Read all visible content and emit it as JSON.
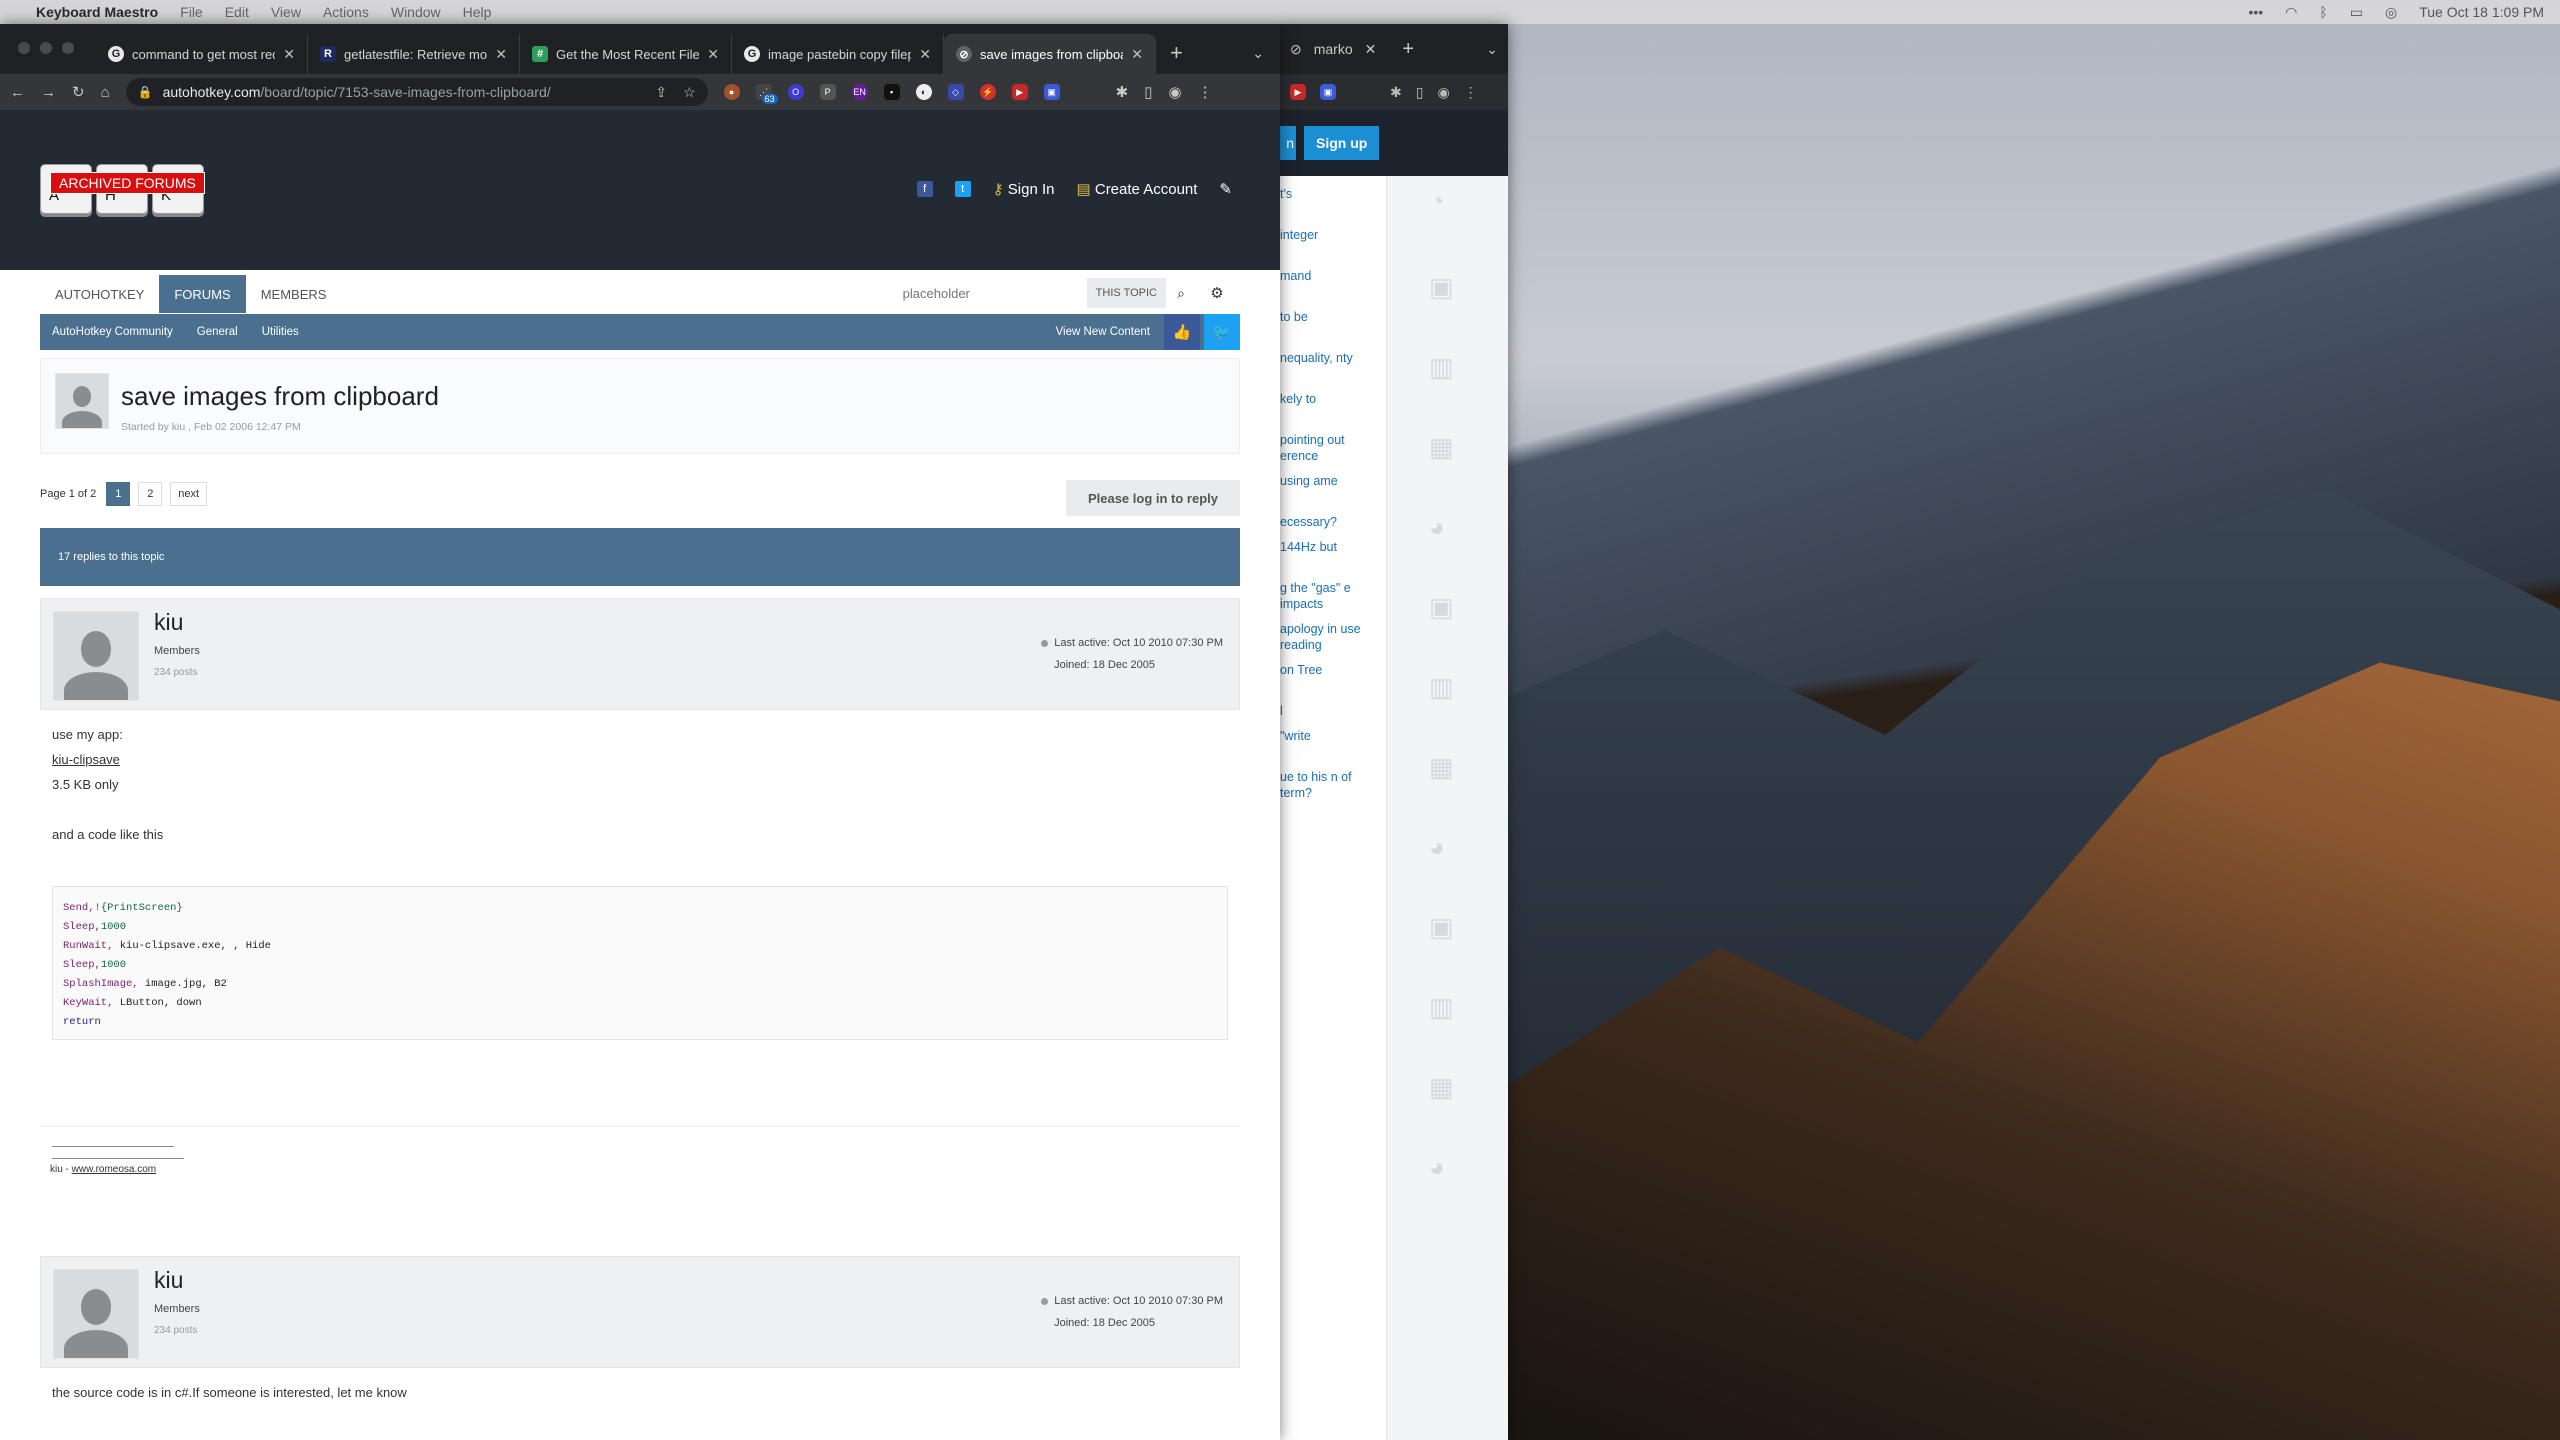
{
  "menubar": {
    "app": "Keyboard Maestro",
    "items": [
      "File",
      "Edit",
      "View",
      "Actions",
      "Window",
      "Help"
    ],
    "clock": "Tue Oct 18  1:09 PM"
  },
  "browser": {
    "tabs": [
      {
        "title": "command to get most rec",
        "favicon": "G"
      },
      {
        "title": "getlatestfile: Retrieve mo",
        "favicon": "R"
      },
      {
        "title": "Get the Most Recent File",
        "favicon": "#"
      },
      {
        "title": "image pastebin copy filep",
        "favicon": "G"
      },
      {
        "title": "save images from clipboa",
        "favicon": "⊘"
      }
    ],
    "url_domain": "autohotkey.com",
    "url_path": "/board/topic/7153-save-images-from-clipboard/",
    "ext_badge": "63"
  },
  "second_window": {
    "tab_title": "marko",
    "signup_label": "Sign up",
    "login_fragment": "n",
    "list_items": [
      "t's",
      "integer",
      "mand",
      "to be",
      "nequality, nty",
      "kely to",
      "pointing out erence",
      "using ame",
      "ecessary?",
      "144Hz but",
      "g the \"gas\" e impacts",
      "apology in use reading",
      "on Tree",
      "l",
      "\"write",
      "ue to his n of term?"
    ]
  },
  "site": {
    "logo_banner": "ARCHIVED FORUMS",
    "logo_keys": [
      "A",
      "H",
      "K"
    ],
    "sign_in": "Sign In",
    "create_account": "Create Account",
    "nav": [
      "AUTOHOTKEY",
      "FORUMS",
      "MEMBERS"
    ],
    "search_placeholder": "placeholder",
    "search_scope": "THIS TOPIC",
    "breadcrumbs": [
      "AutoHotkey Community",
      "General",
      "Utilities"
    ],
    "view_new": "View New Content"
  },
  "topic": {
    "title": "save images from clipboard",
    "meta": "Started by kiu , Feb 02 2006 12:47 PM",
    "page_label": "Page 1 of 2",
    "pages": [
      "1",
      "2",
      "next"
    ],
    "reply_button": "Please log in to reply",
    "replies": "17 replies to this topic"
  },
  "posts": [
    {
      "user": "kiu",
      "group": "Members",
      "count": "234 posts",
      "last_active": "Last active: Oct 10 2010 07:30 PM",
      "joined": "Joined: 18 Dec 2005",
      "line1": "use my app:",
      "link": "kiu-clipsave",
      "line2": "3.5 KB only",
      "line3": "and a code like this",
      "code": [
        {
          "a": "Send,",
          "b": "!{PrintScreen}"
        },
        {
          "a": "Sleep,",
          "b": "1000"
        },
        {
          "a": "RunWait,",
          "b": " kiu-clipsave.exe, , Hide"
        },
        {
          "a": "Sleep,",
          "b": "1000"
        },
        {
          "a": "SplashImage,",
          "b": " image.jpg, B2"
        },
        {
          "a": "KeyWait,",
          "b": " LButton, down"
        },
        {
          "a": "return",
          "b": ""
        }
      ],
      "sig_prefix": "kiu - ",
      "sig_link": "www.romeosa.com"
    },
    {
      "user": "kiu",
      "group": "Members",
      "count": "234 posts",
      "last_active": "Last active: Oct 10 2010 07:30 PM",
      "joined": "Joined: 18 Dec 2005",
      "body": "the source code is in c#.If someone is interested, let me know"
    }
  ]
}
